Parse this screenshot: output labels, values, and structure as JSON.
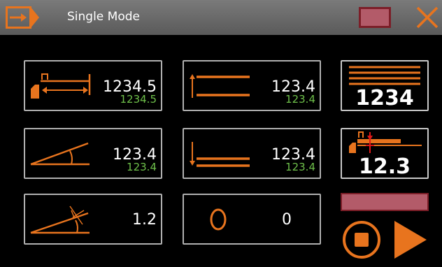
{
  "header": {
    "title": "Single Mode"
  },
  "tiles": {
    "backgauge_x": {
      "value": "1234.5",
      "sub": "1234.5"
    },
    "upper_limit": {
      "value": "123.4",
      "sub": "123.4"
    },
    "angle": {
      "value": "123.4",
      "sub": "123.4"
    },
    "lower_limit": {
      "value": "123.4",
      "sub": "123.4"
    },
    "angle_correction": {
      "value": "1.2"
    },
    "counter": {
      "value": "0"
    }
  },
  "right_panel": {
    "stroke_count": "1234",
    "gauge_position": "12.3"
  },
  "colors": {
    "accent_orange": "#e8741e",
    "value_green": "#6ec04a",
    "status_pink": "#b35b69",
    "status_border": "#7c1e28"
  },
  "icons": [
    "mode-arrow-icon",
    "close-icon",
    "backgauge-icon",
    "upper-limit-icon",
    "angle-icon",
    "lower-limit-icon",
    "angle-correction-icon",
    "counter-icon",
    "stroke-count-icon",
    "gauge-position-icon",
    "stop-icon",
    "play-icon"
  ]
}
